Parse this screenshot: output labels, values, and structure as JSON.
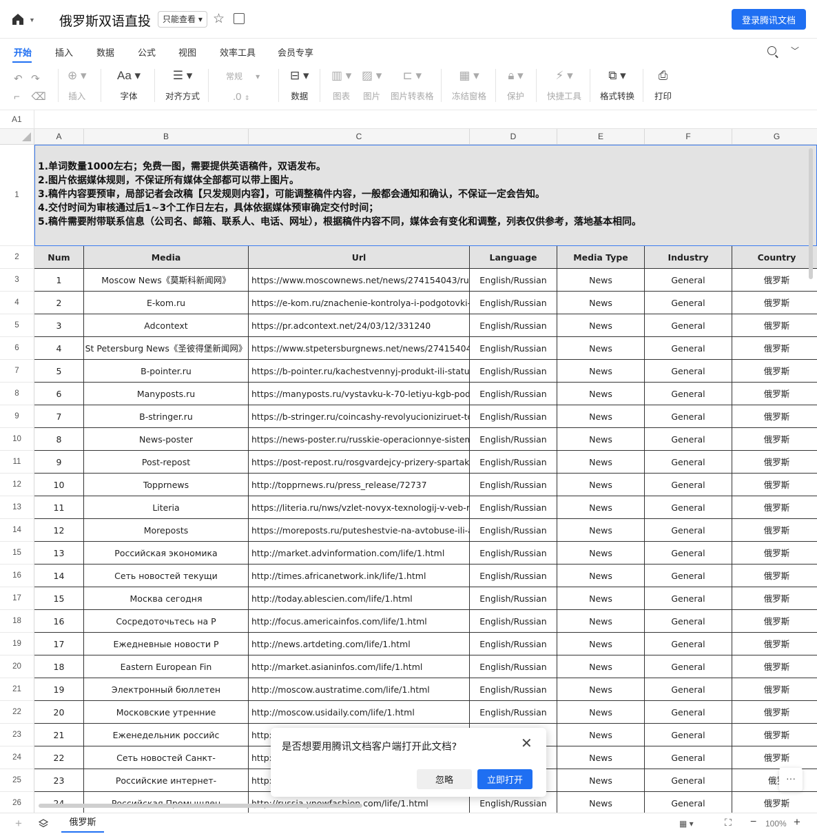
{
  "header": {
    "title": "俄罗斯双语直投",
    "readonly_label": "只能查看",
    "login_label": "登录腾讯文档"
  },
  "menu": {
    "tabs": [
      "开始",
      "插入",
      "数据",
      "公式",
      "视图",
      "效率工具",
      "会员专享"
    ],
    "active": 0
  },
  "toolbar": {
    "insert": "插入",
    "font": "字体",
    "align": "对齐方式",
    "format_select": "常规",
    "decimal": ".0",
    "data": "数据",
    "chart": "图表",
    "image": "图片",
    "image_to_table": "图片转表格",
    "freeze": "冻结窗格",
    "protect": "保护",
    "quick_tools": "快捷工具",
    "format_convert": "格式转换",
    "print": "打印"
  },
  "formula_bar": {
    "cell_ref": "A1"
  },
  "sheet": {
    "columns": [
      "A",
      "B",
      "C",
      "D",
      "E",
      "F",
      "G"
    ],
    "notes": [
      "1.单词数量1000左右；免费一图，需要提供英语稿件，双语发布。",
      "2.图片依据媒体规则，不保证所有媒体全部都可以带上图片。",
      "3.稿件内容要预审，局部记者会改稿【只发规则内容】，可能调整稿件内容，一般都会通知和确认，不保证一定会告知。",
      "4.交付时间为审核通过后1~3个工作日左右，具体依据媒体预审确定交付时间；",
      "5.稿件需要附带联系信息（公司名、邮箱、联系人、电话、网址），根据稿件内容不同，媒体会有变化和调整，列表仅供参考，落地基本相同。"
    ],
    "header_row": [
      "Num",
      "Media",
      "Url",
      "Language",
      "Media Type",
      "Industry",
      "Country"
    ],
    "rows": [
      [
        "1",
        "Moscow News《莫斯科新闻网》",
        "https://www.moscownews.net/news/274154043/russia-r",
        "English/Russian",
        "News",
        "General",
        "俄罗斯"
      ],
      [
        "2",
        "E-kom.ru",
        "https://e-kom.ru/znachenie-kontrolya-i-podgotovki-k-pro",
        "English/Russian",
        "News",
        "General",
        "俄罗斯"
      ],
      [
        "3",
        "Adcontext",
        "https://pr.adcontext.net/24/03/12/331240",
        "English/Russian",
        "News",
        "General",
        "俄罗斯"
      ],
      [
        "4",
        "St Petersburg News《圣彼得堡新闻网》",
        "https://www.stpetersburgnews.net/news/274154044/rus",
        "English/Russian",
        "News",
        "General",
        "俄罗斯"
      ],
      [
        "5",
        "B-pointer.ru",
        "https://b-pointer.ru/kachestvennyj-produkt-ili-status-kom",
        "English/Russian",
        "News",
        "General",
        "俄罗斯"
      ],
      [
        "6",
        "Manyposts.ru",
        "https://manyposts.ru/vystavku-k-70-letiyu-kgb-podgotov",
        "English/Russian",
        "News",
        "General",
        "俄罗斯"
      ],
      [
        "7",
        "B-stringer.ru",
        "https://b-stringer.ru/coincashy-revolyucioniziruet-torgov",
        "English/Russian",
        "News",
        "General",
        "俄罗斯"
      ],
      [
        "8",
        "News-poster",
        "https://news-poster.ru/russkie-operacionnye-sistemy-lid",
        "English/Russian",
        "News",
        "General",
        "俄罗斯"
      ],
      [
        "9",
        "Post-repost",
        "https://post-repost.ru/rosgvardejcy-prizery-spartakiady-",
        "English/Russian",
        "News",
        "General",
        "俄罗斯"
      ],
      [
        "10",
        "Topprnews",
        "http://topprnews.ru/press_release/72737",
        "English/Russian",
        "News",
        "General",
        "俄罗斯"
      ],
      [
        "11",
        "Literia",
        "https://literia.ru/nws/vzlet-novyx-texnologij-v-veb-razrab",
        "English/Russian",
        "News",
        "General",
        "俄罗斯"
      ],
      [
        "12",
        "Moreposts",
        "https://moreposts.ru/puteshestvie-na-avtobuse-ili-avtom",
        "English/Russian",
        "News",
        "General",
        "俄罗斯"
      ],
      [
        "13",
        "Российская экономика",
        "http://market.advinformation.com/life/1.html",
        "English/Russian",
        "News",
        "General",
        "俄罗斯"
      ],
      [
        "14",
        "Сеть новостей текущи",
        "http://times.africanetwork.ink/life/1.html",
        "English/Russian",
        "News",
        "General",
        "俄罗斯"
      ],
      [
        "15",
        "Москва сегодня",
        "http://today.ablescien.com/life/1.html",
        "English/Russian",
        "News",
        "General",
        "俄罗斯"
      ],
      [
        "16",
        "Сосредоточьтесь на Р",
        "http://focus.americainfos.com/life/1.html",
        "English/Russian",
        "News",
        "General",
        "俄罗斯"
      ],
      [
        "17",
        "Ежедневные новости Р",
        "http://news.artdeting.com/life/1.html",
        "English/Russian",
        "News",
        "General",
        "俄罗斯"
      ],
      [
        "18",
        "Eastern European Fin",
        "http://market.asianinfos.com/life/1.html",
        "English/Russian",
        "News",
        "General",
        "俄罗斯"
      ],
      [
        "19",
        "Электронный бюллетен",
        "http://moscow.austratime.com/life/1.html",
        "English/Russian",
        "News",
        "General",
        "俄罗斯"
      ],
      [
        "20",
        "Московские утренние",
        "http://moscow.usidaily.com/life/1.html",
        "English/Russian",
        "News",
        "General",
        "俄罗斯"
      ],
      [
        "21",
        "Еженедельник российс",
        "http:",
        "",
        "News",
        "General",
        "俄罗斯"
      ],
      [
        "22",
        "Сеть новостей Санкт-",
        "http:",
        "",
        "News",
        "General",
        "俄罗斯"
      ],
      [
        "23",
        "Российские интернет-",
        "http:",
        "",
        "News",
        "General",
        "俄罗"
      ],
      [
        "24",
        "Российская Промышлен",
        "http://russia.ynowfashion.com/life/1.html",
        "English/Russian",
        "News",
        "General",
        "俄罗斯"
      ]
    ]
  },
  "dialog": {
    "message": "是否想要用腾讯文档客户端打开此文档?",
    "ignore": "忽略",
    "open": "立即打开"
  },
  "bottom": {
    "sheet_name": "俄罗斯",
    "zoom": "100%"
  }
}
